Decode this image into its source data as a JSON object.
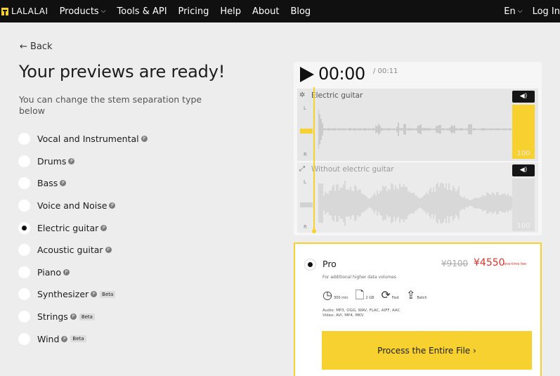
{
  "nav": {
    "logo": "LALALAI",
    "items": [
      {
        "label": "Products",
        "chevron": true
      },
      {
        "label": "Tools & API",
        "chevron": false
      },
      {
        "label": "Pricing",
        "chevron": false
      },
      {
        "label": "Help",
        "chevron": false
      },
      {
        "label": "About",
        "chevron": false
      },
      {
        "label": "Blog",
        "chevron": false
      }
    ],
    "language": "En",
    "login": "Log In"
  },
  "back_label": "← Back",
  "title": "Your previews are ready!",
  "subtitle": "You can change the stem separation type below",
  "options": [
    {
      "label": "Vocal and Instrumental",
      "pro": true,
      "beta": false,
      "selected": false
    },
    {
      "label": "Drums",
      "pro": true,
      "beta": false,
      "selected": false
    },
    {
      "label": "Bass",
      "pro": true,
      "beta": false,
      "selected": false
    },
    {
      "label": "Voice and Noise",
      "pro": true,
      "beta": false,
      "selected": false
    },
    {
      "label": "Electric guitar",
      "pro": true,
      "beta": false,
      "selected": true
    },
    {
      "label": "Acoustic guitar",
      "pro": true,
      "beta": false,
      "selected": false
    },
    {
      "label": "Piano",
      "pro": true,
      "beta": false,
      "selected": false
    },
    {
      "label": "Synthesizer",
      "pro": true,
      "beta": true,
      "selected": false
    },
    {
      "label": "Strings",
      "pro": true,
      "beta": true,
      "selected": false
    },
    {
      "label": "Wind",
      "pro": true,
      "beta": true,
      "selected": false
    }
  ],
  "pro_badge": "P",
  "beta_label": "Beta",
  "player": {
    "current_time": "00:00",
    "total_time": "/ 00:11",
    "tracks": [
      {
        "label": "Electric guitar",
        "volume": "100",
        "active": true
      },
      {
        "label": "Without electric guitar",
        "volume": "100",
        "active": false
      }
    ],
    "channel_l": "L",
    "channel_r": "R"
  },
  "plan": {
    "name": "Pro",
    "price_old": "¥9100",
    "price_new": "¥4550",
    "price_note": "one-time fee",
    "description": "For additional higher data volumes",
    "features": [
      {
        "icon": "clock-icon",
        "text": "300 min"
      },
      {
        "icon": "file-icon",
        "text": "2 GB"
      },
      {
        "icon": "speed-icon",
        "text": "Fast"
      },
      {
        "icon": "upload-icon",
        "text": "Batch"
      }
    ],
    "audio_formats": "Audio: MP3, OGG, WAV, FLAC, AIFF, AAC",
    "video_formats": "Video: AVI, MP4, MKV",
    "cta": "Process the Entire File  ›"
  },
  "colors": {
    "accent": "#f6d12f",
    "nav_bg": "#101010",
    "price_red": "#e0312c"
  }
}
